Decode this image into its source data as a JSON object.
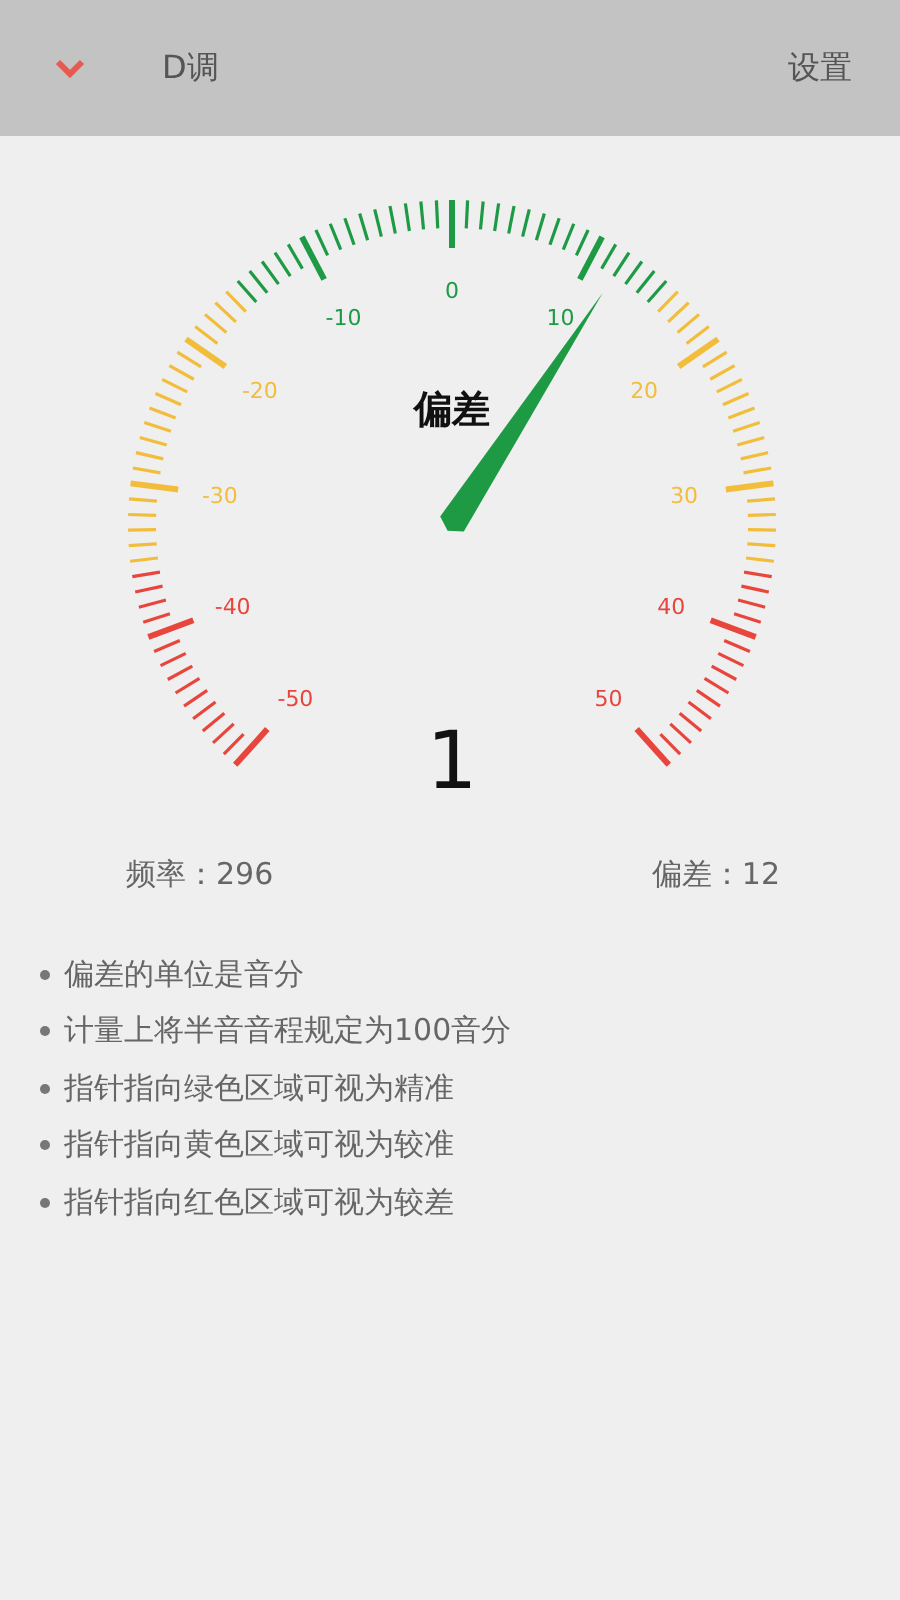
{
  "header": {
    "key": "D调",
    "settings": "设置"
  },
  "gauge": {
    "title": "偏差",
    "value": "1",
    "level": 0.62,
    "ticks": [
      {
        "label": "-50",
        "color": "#e8453c"
      },
      {
        "label": "-40",
        "color": "#e8453c"
      },
      {
        "label": "-30",
        "color": "#f2bd3a"
      },
      {
        "label": "-20",
        "color": "#f2bd3a"
      },
      {
        "label": "-10",
        "color": "#1e9a45"
      },
      {
        "label": "0",
        "color": "#1e9a45"
      },
      {
        "label": "10",
        "color": "#1e9a45"
      },
      {
        "label": "20",
        "color": "#f2bd3a"
      },
      {
        "label": "30",
        "color": "#f2bd3a"
      },
      {
        "label": "40",
        "color": "#e8453c"
      },
      {
        "label": "50",
        "color": "#e8453c"
      }
    ]
  },
  "readings": [
    "频率：296",
    "偏差：12"
  ],
  "notes": [
    "偏差的单位是音分",
    "计量上将半音音程规定为100音分",
    "指针指向绿色区域可视为精准",
    "指针指向黄色区域可视为较准",
    "指针指向红色区域可视为较差"
  ]
}
